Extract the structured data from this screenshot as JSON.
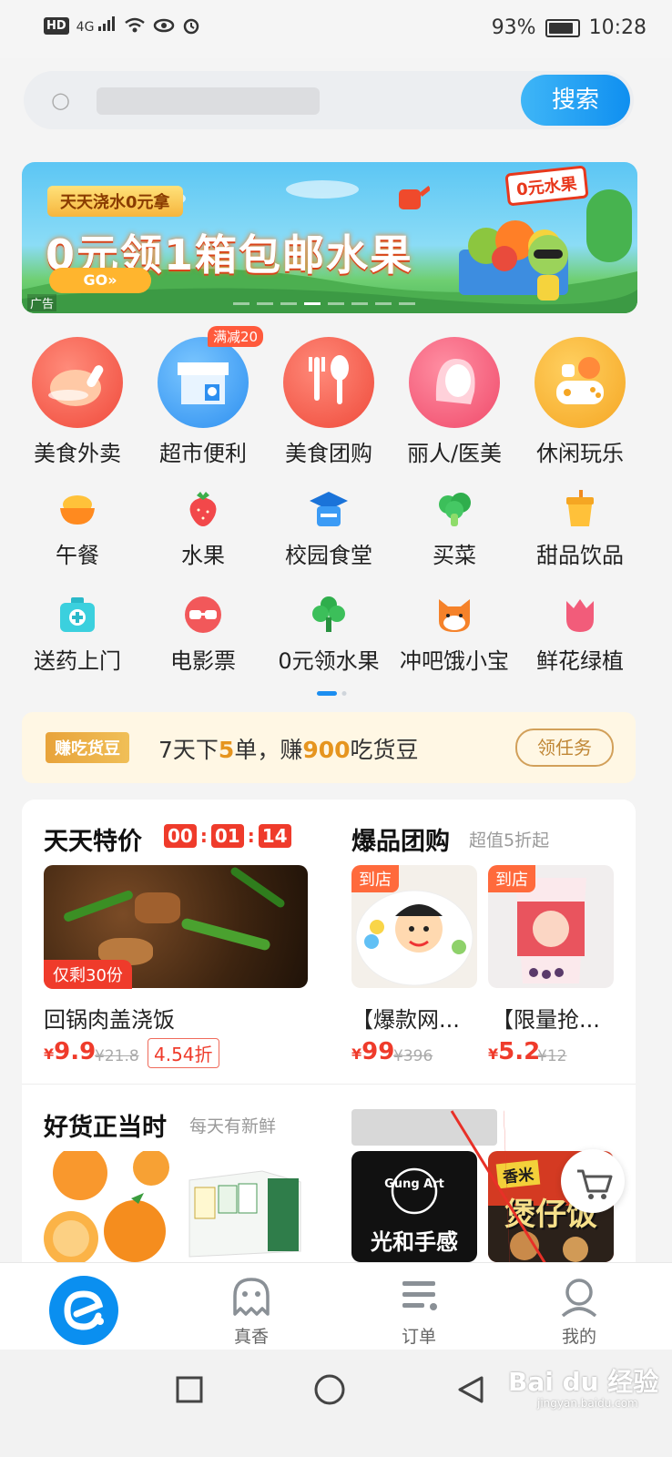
{
  "status_bar": {
    "network_badge": "HD",
    "signal": "4G",
    "battery": "93%",
    "time": "10:28",
    "battery_level": 0.93
  },
  "search": {
    "button_label": "搜索"
  },
  "banner": {
    "tag": "天天浇水0元拿",
    "title": "0元领1箱包邮水果",
    "go": "GO»",
    "sign": "0元水果",
    "ad_label": "广告"
  },
  "categories_big": [
    {
      "label": "美食外卖",
      "icon": "roast-chicken-icon"
    },
    {
      "label": "超市便利",
      "icon": "store-icon",
      "badge": "满减20"
    },
    {
      "label": "美食团购",
      "icon": "fork-spoon-icon"
    },
    {
      "label": "丽人/医美",
      "icon": "woman-icon"
    },
    {
      "label": "休闲玩乐",
      "icon": "game-icon"
    }
  ],
  "categories_small": [
    {
      "label": "午餐",
      "icon": "rice-bowl-icon"
    },
    {
      "label": "水果",
      "icon": "strawberry-icon"
    },
    {
      "label": "校园食堂",
      "icon": "graduation-cap-icon"
    },
    {
      "label": "买菜",
      "icon": "broccoli-icon"
    },
    {
      "label": "甜品饮品",
      "icon": "drink-cup-icon"
    },
    {
      "label": "送药上门",
      "icon": "medicine-kit-icon"
    },
    {
      "label": "电影票",
      "icon": "movie-glasses-icon"
    },
    {
      "label": "0元领水果",
      "icon": "tree-icon"
    },
    {
      "label": "冲吧饿小宝",
      "icon": "shiba-icon"
    },
    {
      "label": "鲜花绿植",
      "icon": "tulip-icon"
    }
  ],
  "task": {
    "tag": "赚吃货豆",
    "text_pre": "7天下",
    "text_num1": "5",
    "text_mid": "单，赚",
    "text_num2": "900",
    "text_post": "吃货豆",
    "button": "领任务"
  },
  "deals": {
    "title": "天天特价",
    "timer": [
      "00",
      "01",
      "14"
    ],
    "remain": "仅剩30份",
    "item_name": "回锅肉盖浇饭",
    "price": "9.9",
    "old_price": "¥21.8",
    "discount": "4.54折"
  },
  "group": {
    "title": "爆品团购",
    "subtitle": "超值5折起",
    "items": [
      {
        "tag": "到店",
        "name": "【爆款网...",
        "price": "99",
        "old_price": "¥396"
      },
      {
        "tag": "到店",
        "name": "【限量抢...",
        "price": "5.2",
        "old_price": "¥12"
      }
    ]
  },
  "goods": {
    "title": "好货正当时",
    "subtitle": "每天有新鲜",
    "brand_text": "光和手感",
    "brand_logo": "Gung Art",
    "poster_text": "煲仔饭",
    "poster_top": "香米"
  },
  "currency": "¥",
  "tabbar": [
    {
      "label": "",
      "icon": "eleme-logo-icon"
    },
    {
      "label": "真香",
      "icon": "ghost-icon"
    },
    {
      "label": "订单",
      "icon": "list-icon"
    },
    {
      "label": "我的",
      "icon": "person-icon"
    }
  ],
  "watermark": {
    "text": "Bai du 经验",
    "sub": "jingyan.baidu.com"
  },
  "colors": {
    "accent": "#0f8ff0",
    "price": "#ef3b2b",
    "gold": "#e6951f"
  }
}
